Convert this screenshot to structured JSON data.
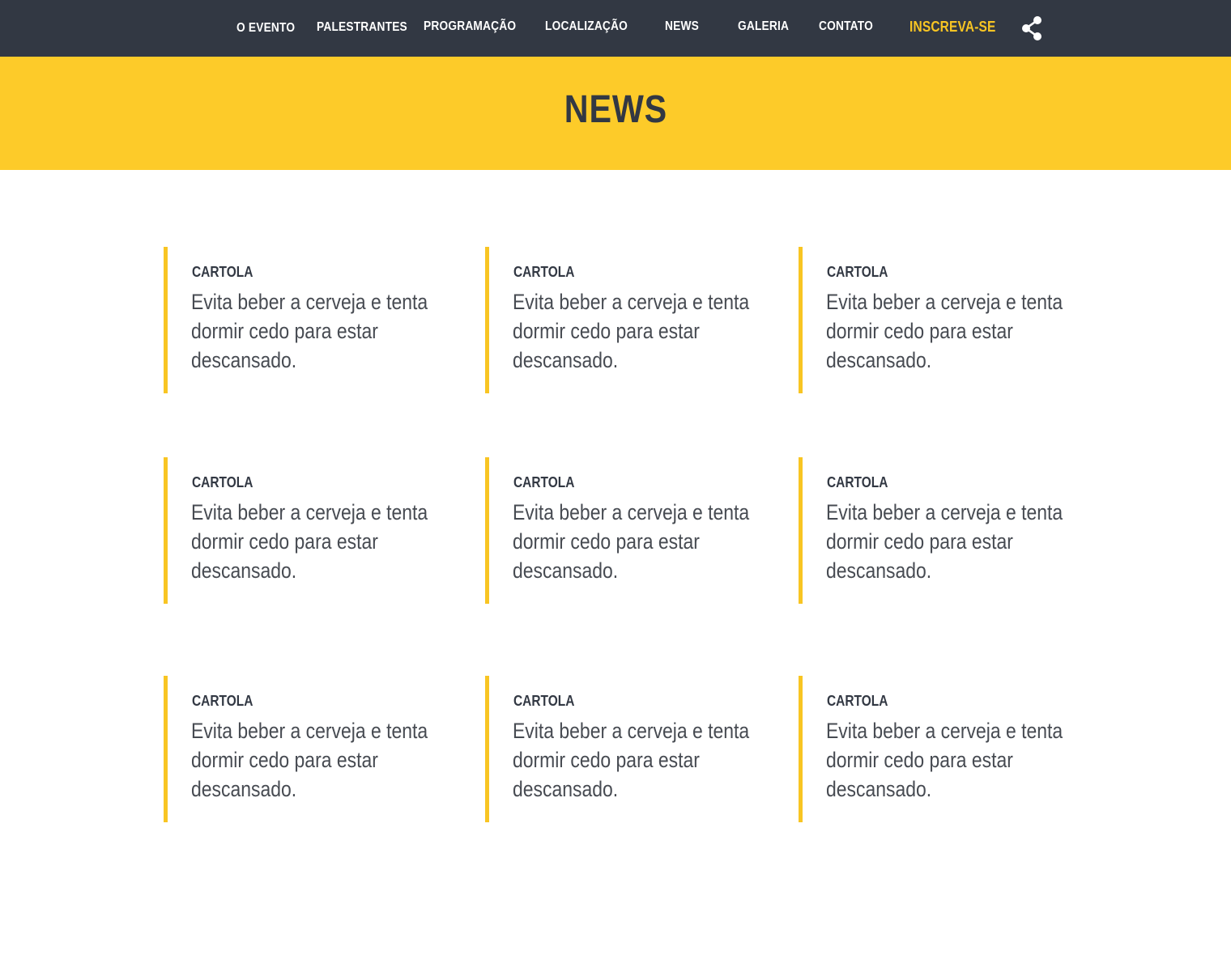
{
  "nav": {
    "items": [
      {
        "label": "O EVENTO"
      },
      {
        "label": "PALESTRANTES"
      },
      {
        "label": "PROGRAMAÇÃO"
      },
      {
        "label": "LOCALIZAÇÃO"
      },
      {
        "label": "NEWS"
      },
      {
        "label": "GALERIA"
      },
      {
        "label": "CONTATO"
      }
    ],
    "cta_label": "INSCREVA-SE",
    "share_icon": "share-icon"
  },
  "banner": {
    "title": "NEWS"
  },
  "news": {
    "items": [
      {
        "kicker": "CARTOLA",
        "text": "Evita beber a cerveja e tenta dormir cedo para estar descansado."
      },
      {
        "kicker": "CARTOLA",
        "text": "Evita beber a cerveja e tenta dormir cedo para estar descansado."
      },
      {
        "kicker": "CARTOLA",
        "text": "Evita beber a cerveja e tenta dormir cedo para estar descansado."
      },
      {
        "kicker": "CARTOLA",
        "text": "Evita beber a cerveja e tenta dormir cedo para estar descansado."
      },
      {
        "kicker": "CARTOLA",
        "text": "Evita beber a cerveja e tenta dormir cedo para estar descansado."
      },
      {
        "kicker": "CARTOLA",
        "text": "Evita beber a cerveja e tenta dormir cedo para estar descansado."
      },
      {
        "kicker": "CARTOLA",
        "text": "Evita beber a cerveja e tenta dormir cedo para estar descansado."
      },
      {
        "kicker": "CARTOLA",
        "text": "Evita beber a cerveja e tenta dormir cedo para estar descansado."
      },
      {
        "kicker": "CARTOLA",
        "text": "Evita beber a cerveja e tenta dormir cedo para estar descansado."
      }
    ]
  },
  "colors": {
    "nav_bg": "#323843",
    "accent": "#fdcb29",
    "cta": "#f8c523",
    "text_dark": "#323843",
    "text_body": "#474b52"
  }
}
